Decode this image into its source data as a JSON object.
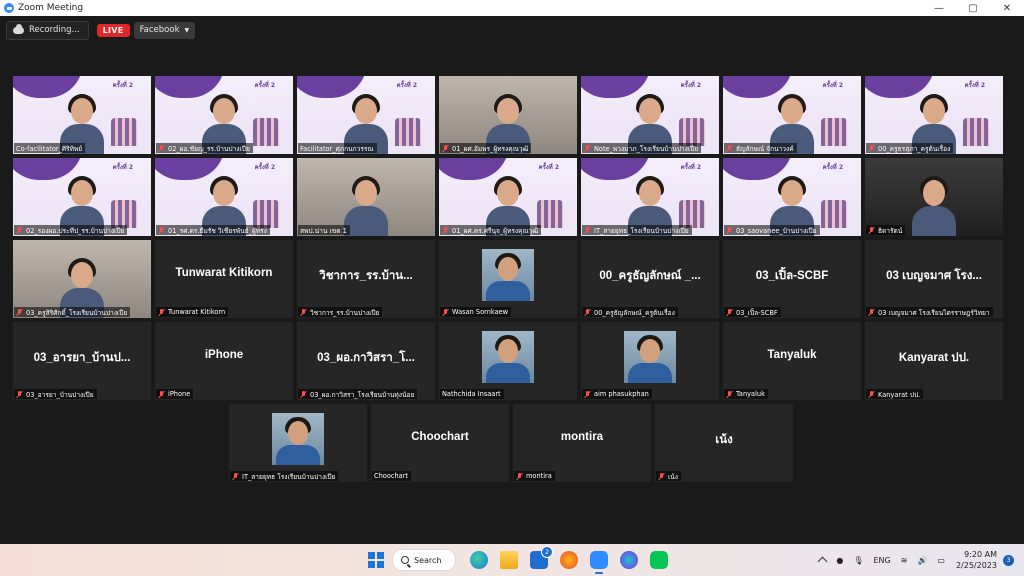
{
  "window": {
    "title": "Zoom Meeting"
  },
  "window_controls": {
    "minimize": "—",
    "maximize": "▢",
    "close": "✕"
  },
  "toolbar": {
    "recording": "Recording...",
    "live": "LIVE",
    "stream": "Facebook",
    "stream_caret": "▼"
  },
  "slide": {
    "badge": "ครั้งที่ 2"
  },
  "participants": [
    {
      "name": "Co-facilitator_ศิริทิพย์",
      "type": "video-slide",
      "active": true,
      "muted": false
    },
    {
      "name": "02_ผอ.ชัยญ_รร.บ้านปางเปีย",
      "type": "video-slide",
      "muted": true
    },
    {
      "name": "Facilitator_ศุภกนกวรรณ",
      "type": "video-slide",
      "muted": false
    },
    {
      "name": "01_ผศ.อัมพร_ผู้ทรงคุณวุฒิ",
      "type": "video-room",
      "muted": true
    },
    {
      "name": "Note_พวงมาภ_โรงเรียนบ้านปางเปีย",
      "type": "video-slide",
      "muted": true
    },
    {
      "name": "ธัญลักษณ์ จักนาวงค์",
      "type": "video-slide",
      "muted": true
    },
    {
      "name": "00_ครูธรสุภา_ครูต้นเรื่อง",
      "type": "video-slide",
      "muted": true
    },
    {
      "name": "02_รองผอ.ประทีป_รร.บ้านปางเปีย",
      "type": "video-slide",
      "muted": true
    },
    {
      "name": "01_รศ.ดร.ธีมรัช วิเชียรพันธ์_ผู้ทรง",
      "type": "video-slide",
      "muted": true
    },
    {
      "name": "สพป.น่าน เขต 1",
      "type": "video-room",
      "muted": false
    },
    {
      "name": "01_ผศ.ดร.ศรีนุจ_ผู้ทรงคุณวุฒิ",
      "type": "video-slide",
      "muted": true
    },
    {
      "name": "IT_สายยุทธ_โรงเรียนบ้านปางเปีย",
      "type": "video-slide",
      "muted": true
    },
    {
      "name": "03_saovanee_บ้านปางเปีย",
      "type": "video-slide",
      "muted": true
    },
    {
      "name": "ธิดารัตน์",
      "type": "video-dark",
      "muted": true
    },
    {
      "name": "03_ครูสิริศักดิ์_โรงเรียนบ้านปางเปีย",
      "type": "video-room",
      "muted": true
    },
    {
      "name": "Tunwarat Kitikorn",
      "display": "Tunwarat Kitikorn",
      "type": "text",
      "muted": true
    },
    {
      "name": "วิชาการ_รร.บ้านปางเปีย",
      "display": "วิชาการ_รร.บ้าน...",
      "type": "text",
      "muted": true
    },
    {
      "name": "Wasan Sornkaew",
      "type": "photo",
      "muted": true
    },
    {
      "name": "00_ครูธัญลักษณ์_ครูต้นเรื่อง",
      "display": "00_ครูธัญลักษณ์ _...",
      "type": "text",
      "muted": true
    },
    {
      "name": "03_เปิ้ล-SCBF",
      "display": "03_เปิ้ล-SCBF",
      "type": "text",
      "muted": true
    },
    {
      "name": "03 เบญจมาศ โรงเรียนไตรราษฎร์วิทยา",
      "display": "03 เบญจมาศ โรง...",
      "type": "text",
      "muted": true
    },
    {
      "name": "03_อารยา_บ้านปางเปีย",
      "display": "03_อารยา_บ้านป...",
      "type": "text",
      "muted": true
    },
    {
      "name": "iPhone",
      "display": "iPhone",
      "type": "text",
      "muted": true
    },
    {
      "name": "03_ผอ.กาวิสรา_โรงเรียนบ้านทุ่งน้อย",
      "display": "03_ผอ.กาวิสรา_โ...",
      "type": "text",
      "muted": true
    },
    {
      "name": "Nathchida Insaart",
      "type": "photo",
      "muted": false
    },
    {
      "name": "aim phasukphan",
      "type": "photo",
      "muted": true
    },
    {
      "name": "Tanyaluk",
      "display": "Tanyaluk",
      "type": "text",
      "muted": true
    },
    {
      "name": "Kanyarat ปป.",
      "display": "Kanyarat ปป.",
      "type": "text",
      "muted": true
    },
    {
      "name": "IT_สายยุทธ โรงเรียนบ้านปางเปีย",
      "type": "photo",
      "muted": true
    },
    {
      "name": "Choochart",
      "display": "Choochart",
      "type": "text",
      "muted": false
    },
    {
      "name": "montira",
      "display": "montira",
      "type": "text",
      "muted": true
    },
    {
      "name": "เน้ง",
      "display": "เน้ง",
      "type": "text",
      "muted": true
    }
  ],
  "taskbar": {
    "search_label": "Search",
    "mail_badge": "2",
    "language": "ENG",
    "time": "9:20 AM",
    "date": "2/25/2023",
    "notification_count": "3"
  },
  "colors": {
    "active_speaker": "#c6e337",
    "live": "#e02828",
    "muted": "#ff4d4d"
  }
}
